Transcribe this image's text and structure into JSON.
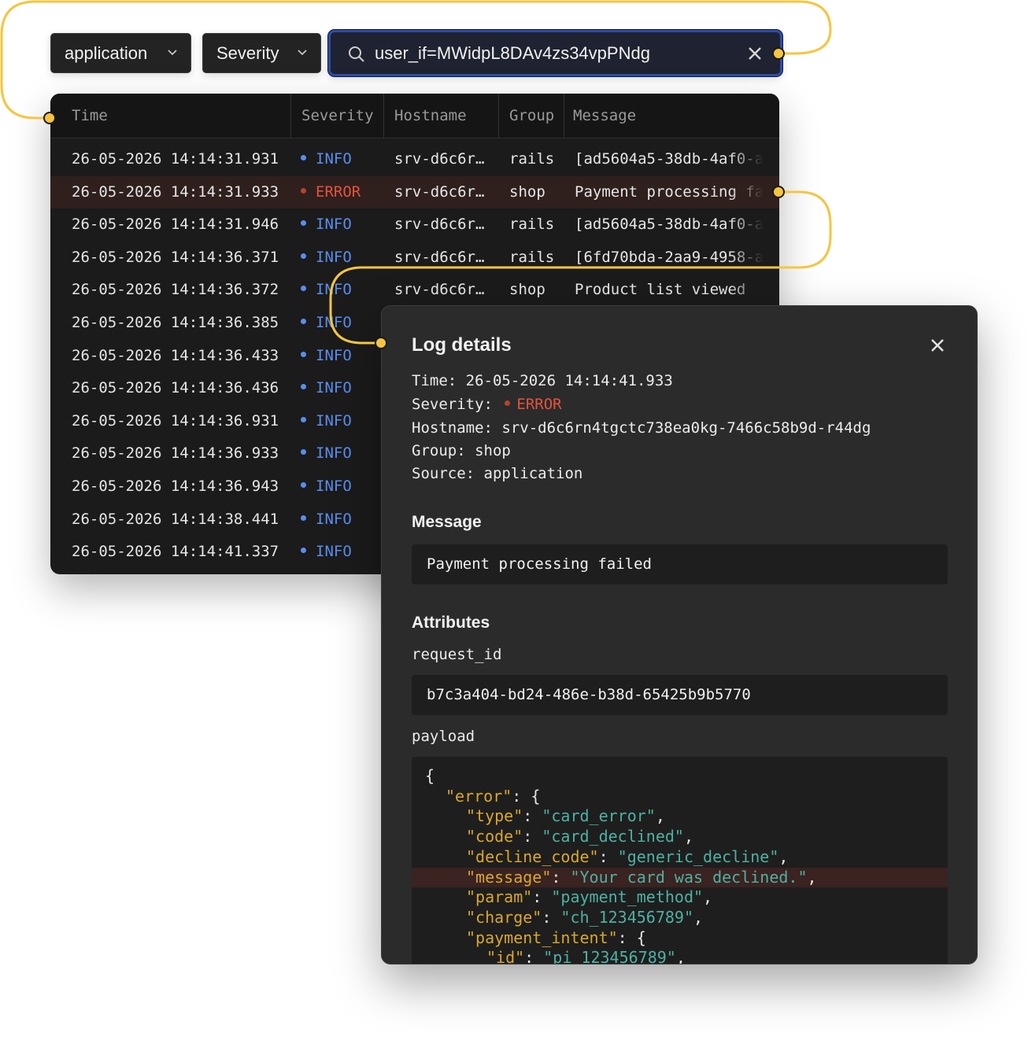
{
  "filters": {
    "source": "application",
    "severity": "Severity",
    "search_value": "user_if=MWidpL8DAv4zs34vpPNdg"
  },
  "table": {
    "columns": [
      "Time",
      "Severity",
      "Hostname",
      "Group",
      "Message"
    ],
    "rows": [
      {
        "time": "26-05-2026 14:14:31.931",
        "severity": "INFO",
        "host": "srv-d6c6r…",
        "group": "rails",
        "message": "[ad5604a5-38db-4af0-a"
      },
      {
        "time": "26-05-2026 14:14:31.933",
        "severity": "ERROR",
        "host": "srv-d6c6r…",
        "group": "shop",
        "message": "Payment processing fa"
      },
      {
        "time": "26-05-2026 14:14:31.946",
        "severity": "INFO",
        "host": "srv-d6c6r…",
        "group": "rails",
        "message": "[ad5604a5-38db-4af0-a"
      },
      {
        "time": "26-05-2026 14:14:36.371",
        "severity": "INFO",
        "host": "srv-d6c6r…",
        "group": "rails",
        "message": "[6fd70bda-2aa9-4958-a"
      },
      {
        "time": "26-05-2026 14:14:36.372",
        "severity": "INFO",
        "host": "srv-d6c6r…",
        "group": "shop",
        "message": "Product list viewed"
      },
      {
        "time": "26-05-2026 14:14:36.385",
        "severity": "INFO",
        "host": "",
        "group": "",
        "message": ""
      },
      {
        "time": "26-05-2026 14:14:36.433",
        "severity": "INFO",
        "host": "",
        "group": "",
        "message": ""
      },
      {
        "time": "26-05-2026 14:14:36.436",
        "severity": "INFO",
        "host": "",
        "group": "",
        "message": ""
      },
      {
        "time": "26-05-2026 14:14:36.931",
        "severity": "INFO",
        "host": "",
        "group": "",
        "message": ""
      },
      {
        "time": "26-05-2026 14:14:36.933",
        "severity": "INFO",
        "host": "",
        "group": "",
        "message": ""
      },
      {
        "time": "26-05-2026 14:14:36.943",
        "severity": "INFO",
        "host": "",
        "group": "",
        "message": ""
      },
      {
        "time": "26-05-2026 14:14:38.441",
        "severity": "INFO",
        "host": "",
        "group": "",
        "message": ""
      },
      {
        "time": "26-05-2026 14:14:41.337",
        "severity": "INFO",
        "host": "",
        "group": "",
        "message": ""
      }
    ]
  },
  "detail": {
    "title": "Log details",
    "time_label": "Time:",
    "time": "26-05-2026 14:14:41.933",
    "severity_label": "Severity:",
    "severity": "ERROR",
    "hostname_label": "Hostname:",
    "hostname": "srv-d6c6rn4tgctc738ea0kg-7466c58b9d-r44dg",
    "group_label": "Group:",
    "group": "shop",
    "source_label": "Source:",
    "source": "application",
    "message_heading": "Message",
    "message": "Payment processing failed",
    "attributes_heading": "Attributes",
    "request_id_label": "request_id",
    "request_id": "b7c3a404-bd24-486e-b38d-65425b9b5770",
    "payload_label": "payload",
    "payload_lines": [
      {
        "indent": 0,
        "parts": [
          {
            "t": "p",
            "v": "{"
          }
        ]
      },
      {
        "indent": 1,
        "parts": [
          {
            "t": "k",
            "v": "\"error\""
          },
          {
            "t": "p",
            "v": ": {"
          }
        ]
      },
      {
        "indent": 2,
        "parts": [
          {
            "t": "k",
            "v": "\"type\""
          },
          {
            "t": "p",
            "v": ": "
          },
          {
            "t": "s",
            "v": "\"card_error\""
          },
          {
            "t": "p",
            "v": ","
          }
        ]
      },
      {
        "indent": 2,
        "parts": [
          {
            "t": "k",
            "v": "\"code\""
          },
          {
            "t": "p",
            "v": ": "
          },
          {
            "t": "s",
            "v": "\"card_declined\""
          },
          {
            "t": "p",
            "v": ","
          }
        ]
      },
      {
        "indent": 2,
        "parts": [
          {
            "t": "k",
            "v": "\"decline_code\""
          },
          {
            "t": "p",
            "v": ": "
          },
          {
            "t": "s",
            "v": "\"generic_decline\""
          },
          {
            "t": "p",
            "v": ","
          }
        ]
      },
      {
        "indent": 2,
        "highlight": true,
        "parts": [
          {
            "t": "k",
            "v": "\"message\""
          },
          {
            "t": "p",
            "v": ": "
          },
          {
            "t": "s",
            "v": "\"Your card was declined.\""
          },
          {
            "t": "p",
            "v": ","
          }
        ]
      },
      {
        "indent": 2,
        "parts": [
          {
            "t": "k",
            "v": "\"param\""
          },
          {
            "t": "p",
            "v": ": "
          },
          {
            "t": "s",
            "v": "\"payment_method\""
          },
          {
            "t": "p",
            "v": ","
          }
        ]
      },
      {
        "indent": 2,
        "parts": [
          {
            "t": "k",
            "v": "\"charge\""
          },
          {
            "t": "p",
            "v": ": "
          },
          {
            "t": "s",
            "v": "\"ch_123456789\""
          },
          {
            "t": "p",
            "v": ","
          }
        ]
      },
      {
        "indent": 2,
        "parts": [
          {
            "t": "k",
            "v": "\"payment_intent\""
          },
          {
            "t": "p",
            "v": ": {"
          }
        ]
      },
      {
        "indent": 3,
        "parts": [
          {
            "t": "k",
            "v": "\"id\""
          },
          {
            "t": "p",
            "v": ": "
          },
          {
            "t": "s",
            "v": "\"pi_123456789\""
          },
          {
            "t": "p",
            "v": ","
          }
        ]
      }
    ]
  },
  "colors": {
    "connector": "#f5c542",
    "info": "#5b8def",
    "error": "#e5533d",
    "json_key": "#d9a72e",
    "json_string": "#4fb0a4"
  },
  "icons": {
    "source_chevron": "chevron-down-icon",
    "severity_chevron": "chevron-down-icon",
    "search": "search-icon",
    "clear": "close-icon",
    "detail_close": "close-icon"
  }
}
